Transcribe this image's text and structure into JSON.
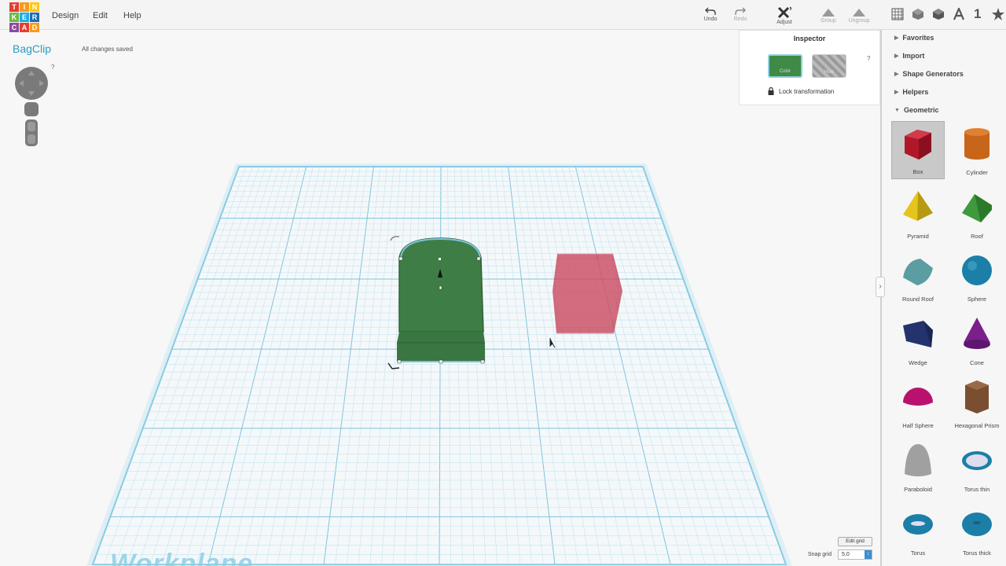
{
  "app": {
    "logo_letters": [
      "TIN",
      "KER",
      "CAD"
    ],
    "logo_colors": [
      "#e43d30",
      "#f59b1c",
      "#ffc70d",
      "#6dbb45",
      "#1aaee4",
      "#1f6bb1",
      "#8d4a9e",
      "#e43d30",
      "#f59b1c"
    ]
  },
  "menu": {
    "design": "Design",
    "edit": "Edit",
    "help": "Help"
  },
  "toolbar": {
    "undo": "Undo",
    "redo": "Redo",
    "adjust": "Adjust",
    "group": "Group",
    "ungroup": "Ungroup"
  },
  "view_icons": {
    "num": "1"
  },
  "project": {
    "title": "BagClip",
    "save_status": "All changes saved"
  },
  "inspector": {
    "title": "Inspector",
    "color_label": "Color",
    "hole_label": "Hole",
    "help": "?",
    "lock_label": "Lock transformation"
  },
  "panel": {
    "sections": [
      "Favorites",
      "Import",
      "Shape Generators",
      "Helpers",
      "Geometric"
    ],
    "shapes": [
      {
        "name": "Box",
        "icon": "box-icon",
        "color": "#b0182a"
      },
      {
        "name": "Cylinder",
        "icon": "cylinder-icon",
        "color": "#c7651a"
      },
      {
        "name": "Pyramid",
        "icon": "pyramid-icon",
        "color": "#e5c41c"
      },
      {
        "name": "Roof",
        "icon": "roof-icon",
        "color": "#3e9a3c"
      },
      {
        "name": "Round Roof",
        "icon": "round-roof-icon",
        "color": "#5b9da0"
      },
      {
        "name": "Sphere",
        "icon": "sphere-icon",
        "color": "#1b7fa8"
      },
      {
        "name": "Wedge",
        "icon": "wedge-icon",
        "color": "#24336e"
      },
      {
        "name": "Cone",
        "icon": "cone-icon",
        "color": "#7a1f8c"
      },
      {
        "name": "Half Sphere",
        "icon": "half-sphere-icon",
        "color": "#b8126e"
      },
      {
        "name": "Hexagonal Prism",
        "icon": "hexagonal-prism-icon",
        "color": "#7a4e30"
      },
      {
        "name": "Paraboloid",
        "icon": "paraboloid-icon",
        "color": "#a0a0a0"
      },
      {
        "name": "Torus thin",
        "icon": "torus-thin-icon",
        "color": "#1b7fa8"
      },
      {
        "name": "Torus",
        "icon": "torus-icon",
        "color": "#1b7fa8"
      },
      {
        "name": "Torus thick",
        "icon": "torus-thick-icon",
        "color": "#1b7fa8"
      }
    ]
  },
  "workplane": {
    "label": "Workplane",
    "grid_color": "#9ad3e6",
    "shape_color": "#3e7d46",
    "box_color": "#c2354e"
  },
  "grid": {
    "edit_grid": "Edit grid",
    "snap_label": "Snap grid",
    "snap_value": "5.0"
  },
  "help_q": "?"
}
